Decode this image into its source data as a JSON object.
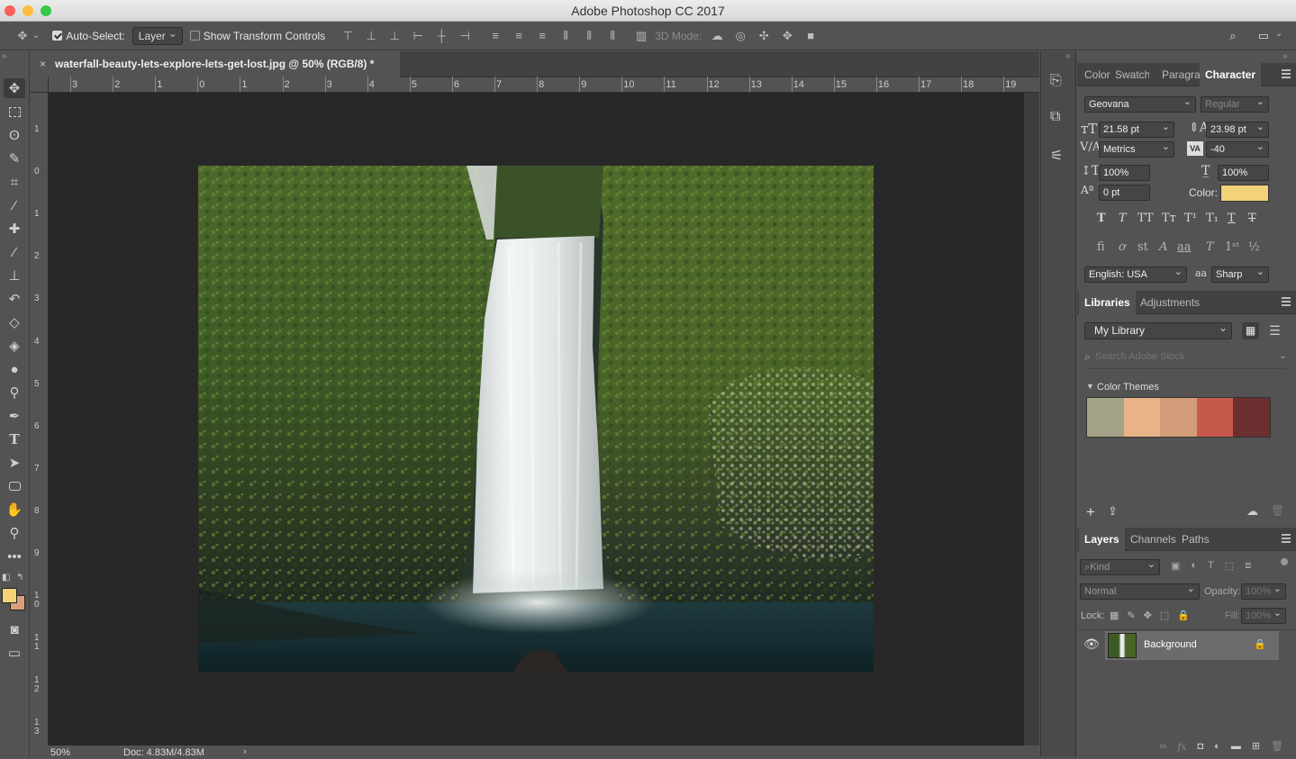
{
  "app": {
    "title": "Adobe Photoshop CC 2017"
  },
  "options_bar": {
    "auto_select_label": "Auto-Select:",
    "auto_select_value": "Layer",
    "show_transform_label": "Show Transform Controls",
    "mode_3d_label": "3D Mode:"
  },
  "document": {
    "tab_title": "waterfall-beauty-lets-explore-lets-get-lost.jpg @ 50% (RGB/8) *",
    "zoom": "50%",
    "doc_size": "Doc: 4.83M/4.83M"
  },
  "rulers": {
    "horizontal": [
      "3",
      "2",
      "1",
      "0",
      "1",
      "2",
      "3",
      "4",
      "5",
      "6",
      "7",
      "8",
      "9",
      "10",
      "11",
      "12",
      "13",
      "14",
      "15",
      "16",
      "17",
      "18",
      "19"
    ],
    "vertical": [
      "1",
      "0",
      "1",
      "2",
      "3",
      "4",
      "5",
      "6",
      "7",
      "8",
      "9",
      "1 0",
      "1 1",
      "1 2",
      "1 3"
    ]
  },
  "character_panel": {
    "tabs": [
      "Color",
      "Swatches",
      "Paragraph",
      "Character"
    ],
    "font_family": "Geovana",
    "font_style": "Regular",
    "font_size": "21.58 pt",
    "leading": "23.98 pt",
    "kerning": "Metrics",
    "tracking": "-40",
    "vertical_scale": "100%",
    "horizontal_scale": "100%",
    "baseline_shift": "0 pt",
    "color_label": "Color:",
    "color_value": "#f3d27a",
    "language": "English: USA",
    "antialias_symbol": "aa",
    "antialias": "Sharp"
  },
  "libraries_panel": {
    "tabs": [
      "Libraries",
      "Adjustments"
    ],
    "library": "My Library",
    "search_placeholder": "Search Adobe Stock",
    "section": "Color Themes",
    "swatches": [
      "#a5a387",
      "#e8b487",
      "#d29c78",
      "#c55a4c",
      "#6b2f2f"
    ]
  },
  "layers_panel": {
    "tabs": [
      "Layers",
      "Channels",
      "Paths"
    ],
    "filter": "Kind",
    "blend_mode": "Normal",
    "opacity_label": "Opacity:",
    "opacity": "100%",
    "lock_label": "Lock:",
    "fill_label": "Fill:",
    "fill": "100%",
    "layers": [
      {
        "name": "Background",
        "visible": true,
        "locked": true
      }
    ]
  },
  "colors": {
    "foreground": "#f3d27a",
    "background": "#d9a07a"
  }
}
